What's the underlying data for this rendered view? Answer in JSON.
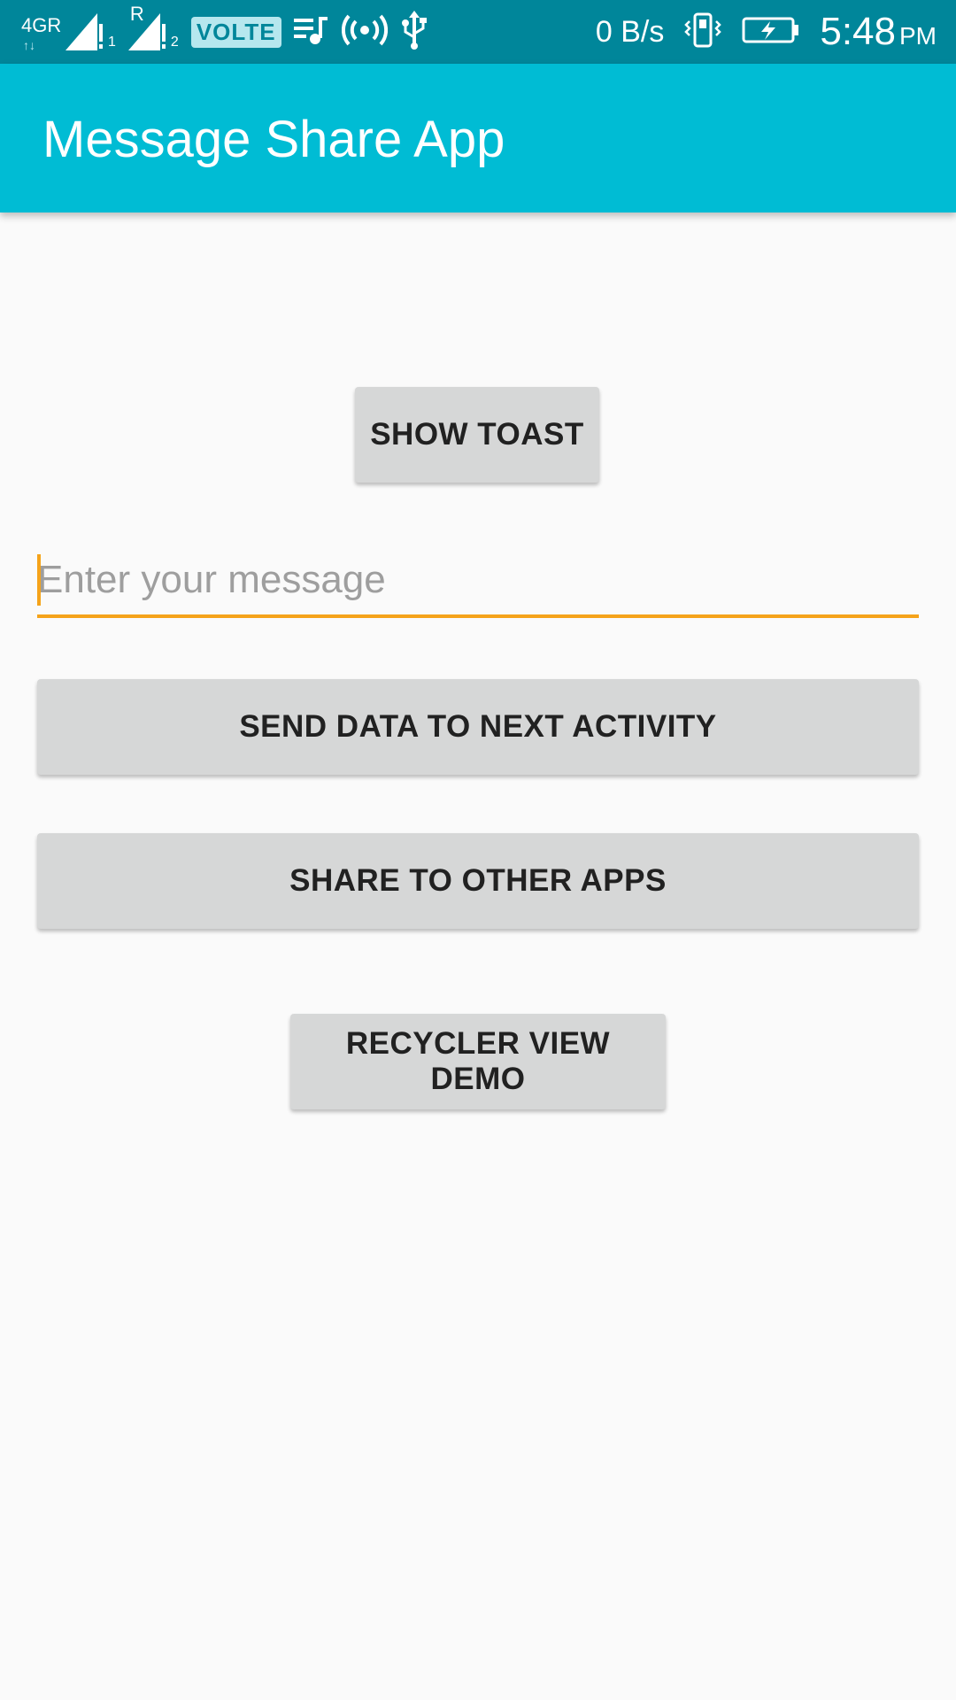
{
  "status_bar": {
    "network_type": "4GR",
    "sim2_roaming": "R",
    "sim1_index": "1",
    "sim2_index": "2",
    "volte": "VOLTE",
    "data_speed": "0 B/s",
    "time": "5:48",
    "ampm": "PM",
    "icons": [
      "signal-icon",
      "music-icon",
      "hotspot-icon",
      "usb-icon",
      "vibrate-icon",
      "battery-charging-icon"
    ]
  },
  "app_bar": {
    "title": "Message Share App",
    "color": "#00bcd4"
  },
  "main": {
    "show_toast_label": "SHOW TOAST",
    "message_placeholder": "Enter your message",
    "message_value": "",
    "send_data_label": "SEND DATA TO NEXT ACTIVITY",
    "share_label": "SHARE TO OTHER APPS",
    "recycler_label": "RECYCLER VIEW DEMO"
  },
  "colors": {
    "accent": "#f5a31a",
    "status_bar": "#00869a",
    "button": "#d6d7d7"
  }
}
